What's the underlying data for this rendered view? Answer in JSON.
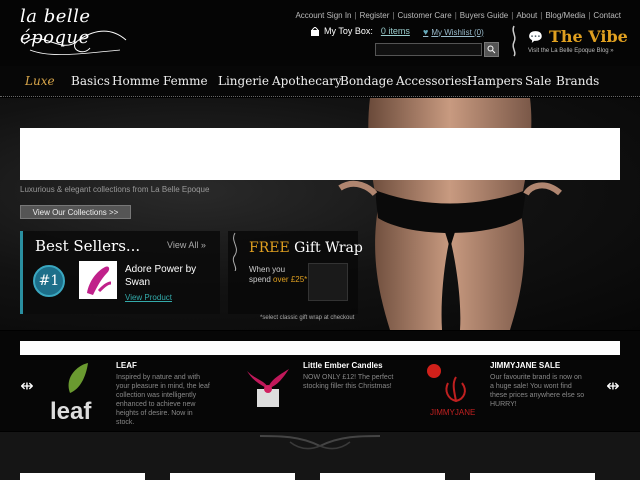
{
  "header": {
    "logo_text": "la belle époque",
    "toplinks": [
      "Account Sign In",
      "Register",
      "Customer Care",
      "Buyers Guide",
      "About",
      "Blog/Media",
      "Contact"
    ],
    "toybox_label": "My Toy Box:",
    "toybox_items": "0 items",
    "wishlist": "My Wishlist (0)",
    "search_placeholder": "",
    "vibe_title": "The Vibe",
    "vibe_sub": "Visit the La Belle Epoque Blog »"
  },
  "nav": {
    "items": [
      "Luxe",
      "Basics",
      "Homme",
      "Femme",
      "Lingerie",
      "Apothecary",
      "Bondage",
      "Accessories",
      "Hampers",
      "Sale",
      "Brands"
    ]
  },
  "hero": {
    "tagline": "Luxurious & elegant collections from La Belle Epoque",
    "view_collections": "View Our Collections >>"
  },
  "bestsellers": {
    "title": "Best Sellers...",
    "view_all": "View All »",
    "rank": "#1",
    "product_name": "Adore Power by Swan",
    "view_product": "View Product"
  },
  "gift": {
    "free": "FREE",
    "title_rest": " Gift Wrap",
    "text_a": "When you spend ",
    "text_hl": "over £25*",
    "note": "*select classic gift wrap at checkout"
  },
  "promos": [
    {
      "title": "LEAF",
      "text": "Inspired by nature and with your pleasure in mind, the leaf collection was intelligently enhanced to achieve new heights of desire. Now in stock.",
      "logo": "leaf"
    },
    {
      "title": "Little Ember Candles",
      "text": "NOW ONLY £12! The perfect stocking filler this Christmas!"
    },
    {
      "title": "JIMMYJANE SALE",
      "text": "Our favourite brand is now on a huge sale! You wont find these prices anywhere else so HURRY!",
      "logo": "JIMMYJANE"
    }
  ],
  "colors": {
    "accent_gold": "#e0a020",
    "accent_teal": "#2a8fa0"
  }
}
